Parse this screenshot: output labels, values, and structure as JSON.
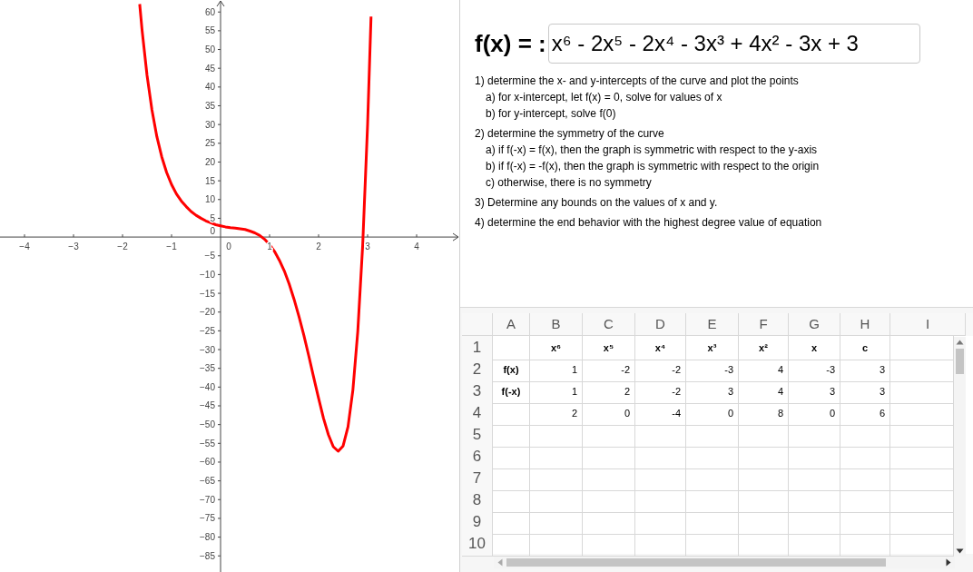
{
  "graph": {
    "chart_data": {
      "type": "line",
      "x": [
        -1.65,
        -1.6,
        -1.5,
        -1.4,
        -1.3,
        -1.2,
        -1.1,
        -1.0,
        -0.9,
        -0.8,
        -0.7,
        -0.6,
        -0.5,
        -0.4,
        -0.3,
        -0.2,
        -0.1,
        0,
        0.1,
        0.2,
        0.3,
        0.4,
        0.5,
        0.6,
        0.7,
        0.8,
        0.9,
        1.0,
        1.1,
        1.2,
        1.3,
        1.4,
        1.5,
        1.6,
        1.7,
        1.8,
        1.9,
        2.0,
        2.1,
        2.2,
        2.3,
        2.4,
        2.5,
        2.6,
        2.7,
        2.8,
        2.9,
        3.0,
        3.07
      ],
      "series": [
        {
          "color": "#ff0000",
          "values": [
            62.1,
            55,
            43.1,
            33.9,
            26.8,
            21.4,
            17.2,
            14,
            11.5,
            9.6,
            8.1,
            6.8,
            5.8,
            5,
            4.3,
            3.8,
            3.3,
            3,
            2.7,
            2.5,
            2.4,
            2.2,
            2,
            1.6,
            1.1,
            0.4,
            -0.6,
            -2,
            -3.8,
            -6.2,
            -9,
            -12.5,
            -16.6,
            -21.2,
            -26.2,
            -31.7,
            -37.4,
            -43,
            -48.3,
            -52.7,
            -55.9,
            -57.1,
            -55.7,
            -50.6,
            -40.8,
            -25.1,
            -2.1,
            30,
            58.8
          ]
        }
      ],
      "xlim": [
        -4.5,
        4.87
      ],
      "ylim": [
        -89.3,
        63.2
      ],
      "xticks": [
        {
          "value": -4,
          "label": "−4"
        },
        {
          "value": -3,
          "label": "−3"
        },
        {
          "value": -2,
          "label": "−2"
        },
        {
          "value": -1,
          "label": "−1"
        },
        {
          "value": 1,
          "label": "1"
        },
        {
          "value": 2,
          "label": "2"
        },
        {
          "value": 3,
          "label": "3"
        },
        {
          "value": 4,
          "label": "4"
        }
      ],
      "yticks": [
        {
          "value": 60,
          "label": "60"
        },
        {
          "value": 55,
          "label": "55"
        },
        {
          "value": 50,
          "label": "50"
        },
        {
          "value": 45,
          "label": "45"
        },
        {
          "value": 40,
          "label": "40"
        },
        {
          "value": 35,
          "label": "35"
        },
        {
          "value": 30,
          "label": "30"
        },
        {
          "value": 25,
          "label": "25"
        },
        {
          "value": 20,
          "label": "20"
        },
        {
          "value": 15,
          "label": "15"
        },
        {
          "value": 10,
          "label": "10"
        },
        {
          "value": 5,
          "label": "5"
        },
        {
          "value": -5,
          "label": "−5"
        },
        {
          "value": -10,
          "label": "−10"
        },
        {
          "value": -15,
          "label": "−15"
        },
        {
          "value": -20,
          "label": "−20"
        },
        {
          "value": -25,
          "label": "−25"
        },
        {
          "value": -30,
          "label": "−30"
        },
        {
          "value": -35,
          "label": "−35"
        },
        {
          "value": -40,
          "label": "−40"
        },
        {
          "value": -45,
          "label": "−45"
        },
        {
          "value": -50,
          "label": "−50"
        },
        {
          "value": -55,
          "label": "−55"
        },
        {
          "value": -60,
          "label": "−60"
        },
        {
          "value": -65,
          "label": "−65"
        },
        {
          "value": -70,
          "label": "−70"
        },
        {
          "value": -75,
          "label": "−75"
        },
        {
          "value": -80,
          "label": "−80"
        },
        {
          "value": -85,
          "label": "−85"
        }
      ]
    },
    "origin_labels": [
      "0",
      "0"
    ]
  },
  "formula": {
    "label": "f(x) = :",
    "value": "x⁶ - 2x⁵ - 2x⁴ - 3x³ + 4x² - 3x + 3"
  },
  "instructions": [
    {
      "text": "1) determine the x- and y-intercepts of the curve and plot the points",
      "children": [
        {
          "text": "a) for x-intercept, let f(x) = 0, solve for values of x"
        },
        {
          "text": "b) for y-intercept, solve f(0)"
        }
      ]
    },
    {
      "text": "2) determine the symmetry of the curve",
      "children": [
        {
          "text": "a) if f(-x) = f(x), then the graph is symmetric with respect to the y-axis"
        },
        {
          "text": "b) if f(-x) = -f(x), then the graph is symmetric with respect to the origin"
        },
        {
          "text": "c) otherwise, there is no symmetry"
        }
      ]
    },
    {
      "text": "3) Determine any bounds on the values of x and y."
    },
    {
      "text": "4) determine the end behavior with the highest degree value of equation"
    }
  ],
  "spreadsheet": {
    "columns": [
      "A",
      "B",
      "C",
      "D",
      "E",
      "F",
      "G",
      "H",
      "I"
    ],
    "rows": [
      {
        "label": "1",
        "kind": "header",
        "cells": [
          null,
          "x⁶",
          "x⁵",
          "x⁴",
          "x³",
          "x²",
          "x",
          "c"
        ]
      },
      {
        "label": "2",
        "kind": "data",
        "cells": [
          "f(x)",
          "1",
          "-2",
          "-2",
          "-3",
          "4",
          "-3",
          "3"
        ]
      },
      {
        "label": "3",
        "kind": "data",
        "cells": [
          "f(-x)",
          "1",
          "2",
          "-2",
          "3",
          "4",
          "3",
          "3"
        ]
      },
      {
        "label": "4",
        "kind": "data",
        "cells": [
          null,
          "2",
          "0",
          "-4",
          "0",
          "8",
          "0",
          "6"
        ]
      },
      {
        "label": "5"
      },
      {
        "label": "6"
      },
      {
        "label": "7"
      },
      {
        "label": "8"
      },
      {
        "label": "9"
      },
      {
        "label": "10"
      }
    ]
  }
}
